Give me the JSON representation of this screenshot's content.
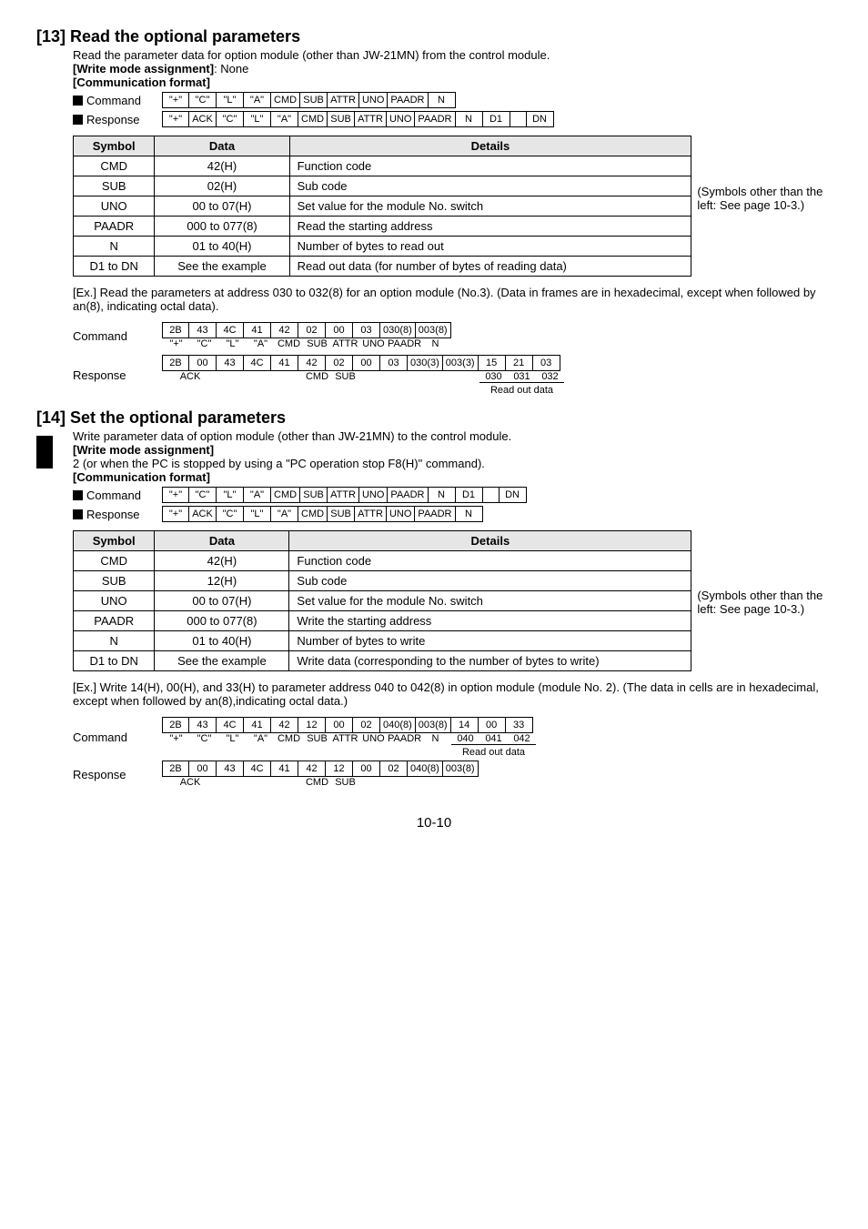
{
  "s13": {
    "heading": "[13]  Read the optional parameters",
    "intro": "Read the parameter data for option module (other than JW-21MN) from the control module.",
    "write_assign_label": "[Write mode assignment]",
    "write_assign_val": ": None",
    "comm_fmt": "[Communication format]",
    "cmd_label": "Command",
    "resp_label": "Response",
    "cmd_cells": [
      "\"+\"",
      "\"C\"",
      "\"L\"",
      "\"A\"",
      "CMD",
      "SUB",
      "ATTR",
      "UNO",
      "PAADR",
      "N"
    ],
    "resp_cells": [
      "\"+\"",
      "ACK",
      "\"C\"",
      "\"L\"",
      "\"A\"",
      "CMD",
      "SUB",
      "ATTR",
      "UNO",
      "PAADR",
      "N",
      "D1",
      "",
      "DN"
    ],
    "table_head": [
      "Symbol",
      "Data",
      "Details"
    ],
    "rows": [
      {
        "s": "CMD",
        "d": "42(H)",
        "t": "Function code"
      },
      {
        "s": "SUB",
        "d": "02(H)",
        "t": "Sub code"
      },
      {
        "s": "UNO",
        "d": "00 to 07(H)",
        "t": "Set value for the module No. switch"
      },
      {
        "s": "PAADR",
        "d": "000 to 077(8)",
        "t": "Read the starting address"
      },
      {
        "s": "N",
        "d": "01 to 40(H)",
        "t": "Number of bytes to read out"
      },
      {
        "s": "D1 to DN",
        "d": "See the example",
        "t": "Read out data (for number of bytes of reading data)"
      }
    ],
    "sidenote": "(Symbols other than the left: See page 10-3.)",
    "ex_note": "[Ex.] Read the parameters at address 030 to 032(8) for an option module (No.3). (Data in frames are in hexadecimal, except when followed by an(8), indicating octal data).",
    "ex_cmd_cells": [
      "2B",
      "43",
      "4C",
      "41",
      "42",
      "02",
      "00",
      "03",
      "030(8)",
      "003(8)"
    ],
    "ex_cmd_und": [
      "\"+\"",
      "\"C\"",
      "\"L\"",
      "\"A\"",
      "CMD",
      "SUB",
      "ATTR",
      "UNO",
      "PAADR",
      "N"
    ],
    "ex_resp_cells": [
      "2B",
      "00",
      "43",
      "4C",
      "41",
      "42",
      "02",
      "00",
      "03",
      "030(3)",
      "003(3)",
      "15",
      "21",
      "03"
    ],
    "ex_resp_und_ack": "ACK",
    "ex_resp_und_cmd": "CMD",
    "ex_resp_und_sub": "SUB",
    "ex_resp_und_030": "030",
    "ex_resp_und_031": "031",
    "ex_resp_und_032": "032",
    "read_out_lbl": "Read out data"
  },
  "s14": {
    "heading": "[14]  Set the optional parameters",
    "intro": "Write parameter data of option module (other than JW-21MN) to the control module.",
    "write_assign_label": "[Write mode assignment]",
    "write_line2": "2 (or when the PC is stopped by using a \"PC operation stop F8(H)\" command).",
    "comm_fmt": "[Communication format]",
    "cmd_label": "Command",
    "resp_label": "Response",
    "cmd_cells": [
      "\"+\"",
      "\"C\"",
      "\"L\"",
      "\"A\"",
      "CMD",
      "SUB",
      "ATTR",
      "UNO",
      "PAADR",
      "N",
      "D1",
      "",
      "DN"
    ],
    "resp_cells": [
      "\"+\"",
      "ACK",
      "\"C\"",
      "\"L\"",
      "\"A\"",
      "CMD",
      "SUB",
      "ATTR",
      "UNO",
      "PAADR",
      "N"
    ],
    "table_head": [
      "Symbol",
      "Data",
      "Details"
    ],
    "rows": [
      {
        "s": "CMD",
        "d": "42(H)",
        "t": "Function code"
      },
      {
        "s": "SUB",
        "d": "12(H)",
        "t": "Sub code"
      },
      {
        "s": "UNO",
        "d": "00 to 07(H)",
        "t": "Set value for the module No. switch"
      },
      {
        "s": "PAADR",
        "d": "000 to 077(8)",
        "t": "Write the starting address"
      },
      {
        "s": "N",
        "d": "01 to 40(H)",
        "t": "Number of bytes to write"
      },
      {
        "s": "D1 to DN",
        "d": "See the example",
        "t": "Write data (corresponding to the number of bytes to write)"
      }
    ],
    "sidenote": "(Symbols other than the left: See page 10-3.)",
    "ex_note": "[Ex.] Write 14(H), 00(H), and 33(H) to parameter address 040 to 042(8) in option module (module No. 2). (The data in cells are in hexadecimal, except when followed by an(8),indicating octal data.)",
    "ex_cmd_cells": [
      "2B",
      "43",
      "4C",
      "41",
      "42",
      "12",
      "00",
      "02",
      "040(8)",
      "003(8)",
      "14",
      "00",
      "33"
    ],
    "ex_cmd_und": [
      "\"+\"",
      "\"C\"",
      "\"L\"",
      "\"A\"",
      "CMD",
      "SUB",
      "ATTR",
      "UNO",
      "PAADR",
      "N",
      "040",
      "041",
      "042"
    ],
    "ex_resp_cells": [
      "2B",
      "00",
      "43",
      "4C",
      "41",
      "42",
      "12",
      "00",
      "02",
      "040(8)",
      "003(8)"
    ],
    "ex_resp_und_ack": "ACK",
    "ex_resp_und_cmd": "CMD",
    "ex_resp_und_sub": "SUB",
    "read_out_lbl": "Read out data"
  },
  "page": "10-10"
}
